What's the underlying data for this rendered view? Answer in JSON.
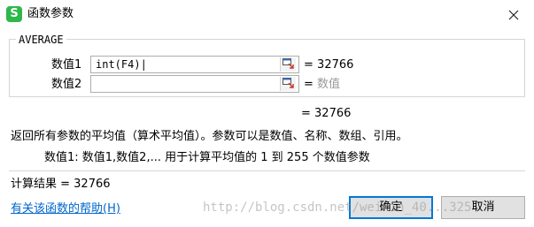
{
  "window": {
    "app_icon": "S",
    "title": "函数参数",
    "close_icon": "close-icon"
  },
  "group": {
    "legend": "AVERAGE"
  },
  "args": [
    {
      "label": "数值1",
      "value": "int(F4)|",
      "placeholder": "",
      "result_prefix": "=",
      "result_value": "32766",
      "result_muted": ""
    },
    {
      "label": "数值2",
      "value": "",
      "placeholder": "",
      "result_prefix": "=",
      "result_value": "",
      "result_muted": "数值"
    }
  ],
  "total": {
    "text": "= 32766"
  },
  "description": {
    "text": "返回所有参数的平均值（算术平均值）。参数可以是数值、名称、数组、引用。"
  },
  "arg_help": {
    "text": "数值1:  数值1,数值2,... 用于计算平均值的 1 到 255 个数值参数"
  },
  "calc_result": {
    "text": "计算结果 = 32766"
  },
  "help_link": {
    "text": "有关该函数的帮助(H)"
  },
  "buttons": {
    "ok": "确定",
    "cancel": "取消"
  },
  "watermark": {
    "text": "http://blog.csdn.net/weixin_40...325"
  },
  "colors": {
    "app_icon_bg": "#2db84c",
    "link": "#0066cc",
    "focus_border": "#0078d7",
    "muted_text": "#9a9a9a"
  }
}
